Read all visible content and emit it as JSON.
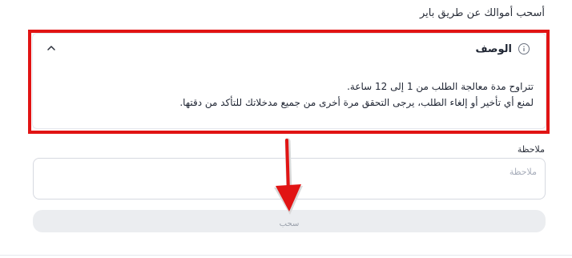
{
  "page": {
    "heading": "أسحب أموالك عن طريق باير"
  },
  "description_card": {
    "title": "الوصف",
    "info_icon": "info-circle-icon",
    "collapse_icon": "chevron-up-icon",
    "lines": [
      "تتراوح مدة معالجة الطلب من 1 إلى 12 ساعة.",
      "لمنع أي تأخير أو إلغاء الطلب، يرجى التحقق مرة أخرى من جميع مدخلاتك للتأكد من دقتها."
    ]
  },
  "note": {
    "label": "ملاحظة",
    "placeholder": "ملاحظة",
    "value": ""
  },
  "withdraw_button": {
    "label": "سحب"
  },
  "annotation": {
    "color": "#e11414"
  }
}
